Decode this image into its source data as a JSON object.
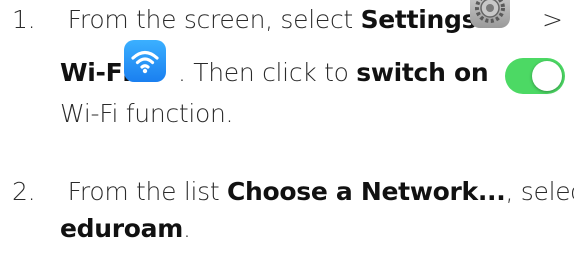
{
  "steps": [
    {
      "number": "1.",
      "line1_prefix": "From the screen, select",
      "settings_label": "Settings",
      "arrow": ">",
      "wifi_label": "Wi-Fi",
      "line2_mid": ". Then click to",
      "switch_label": "switch on",
      "line3": "Wi-Fi function."
    },
    {
      "number": "2.",
      "line1_prefix": "From the list",
      "network_label": "Choose a Network...",
      "line1_suffix": ", select",
      "eduroam_label": "eduroam",
      "period": "."
    }
  ],
  "icons": {
    "settings": "settings-gear-icon",
    "wifi": "wifi-icon",
    "toggle": "toggle-switch-on-icon"
  },
  "colors": {
    "toggle_on": "#4cd964",
    "wifi_blue": "#1a7ff0",
    "settings_gray": "#9a9a9a"
  }
}
